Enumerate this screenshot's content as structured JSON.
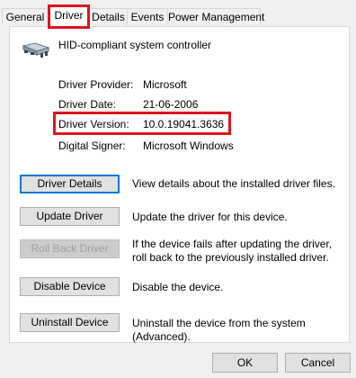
{
  "tabs": [
    {
      "label": "General"
    },
    {
      "label": "Driver"
    },
    {
      "label": "Details"
    },
    {
      "label": "Events"
    },
    {
      "label": "Power Management"
    }
  ],
  "device": {
    "name": "HID-compliant system controller",
    "icon": "hid-device-icon"
  },
  "driver_info": {
    "provider_label": "Driver Provider:",
    "provider_value": "Microsoft",
    "date_label": "Driver Date:",
    "date_value": "21-06-2006",
    "version_label": "Driver Version:",
    "version_value": "10.0.19041.3636",
    "signer_label": "Digital Signer:",
    "signer_value": "Microsoft Windows"
  },
  "actions": [
    {
      "label": "Driver Details",
      "description": "View details about the installed driver files."
    },
    {
      "label": "Update Driver",
      "description": "Update the driver for this device."
    },
    {
      "label": "Roll Back Driver",
      "description": "If the device fails after updating the driver, roll back to the previously installed driver."
    },
    {
      "label": "Disable Device",
      "description": "Disable the device."
    },
    {
      "label": "Uninstall Device",
      "description": "Uninstall the device from the system (Advanced)."
    }
  ],
  "footer": {
    "ok_label": "OK",
    "cancel_label": "Cancel"
  },
  "colors": {
    "highlight": "#e0141e",
    "focus": "#0078d7"
  }
}
